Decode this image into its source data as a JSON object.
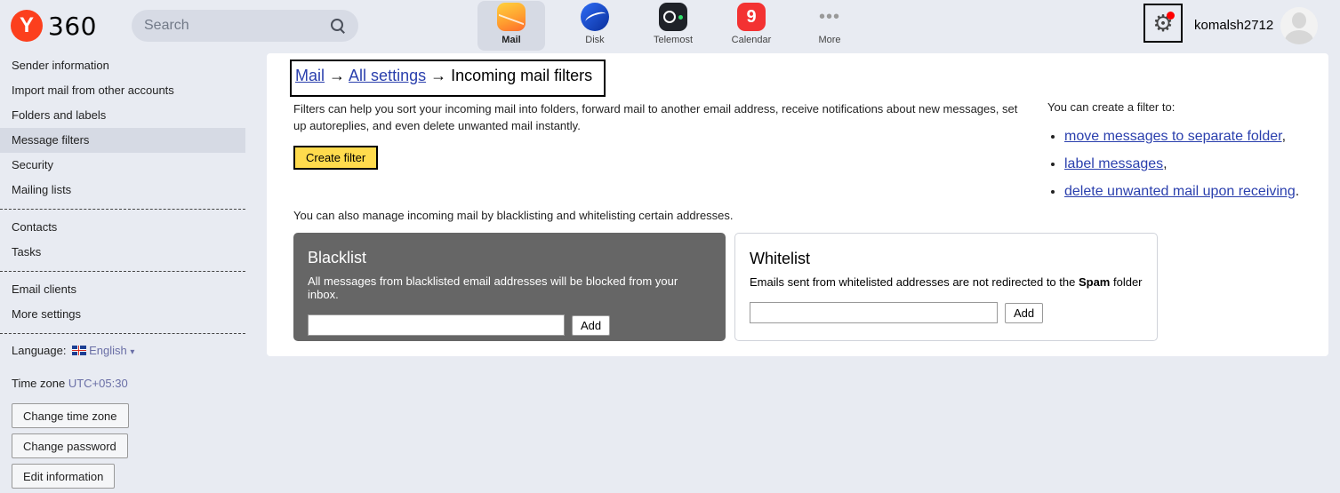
{
  "header": {
    "logo_letter": "Y",
    "logo_text": "360",
    "search_placeholder": "Search",
    "apps": [
      {
        "label": "Mail",
        "icon": "mail-icon",
        "active": true
      },
      {
        "label": "Disk",
        "icon": "disk-icon"
      },
      {
        "label": "Telemost",
        "icon": "telemost-icon"
      },
      {
        "label": "Calendar",
        "icon": "calendar-icon",
        "badge": "9"
      },
      {
        "label": "More",
        "icon": "more-icon",
        "glyph": "•••"
      }
    ],
    "username": "komalsh2712",
    "gear_glyph": "⚙"
  },
  "sidebar": {
    "group1": [
      "Sender information",
      "Import mail from other accounts",
      "Folders and labels",
      "Message filters",
      "Security",
      "Mailing lists"
    ],
    "group2": [
      "Contacts",
      "Tasks"
    ],
    "group3": [
      "Email clients",
      "More settings"
    ],
    "language_label": "Language:",
    "language_value": "English",
    "language_caret": "▾",
    "timezone_label": "Time zone",
    "timezone_value": "UTC+05:30",
    "buttons": [
      "Change time zone",
      "Change password",
      "Edit information"
    ]
  },
  "main": {
    "breadcrumb": {
      "mail": "Mail",
      "arrow": "→",
      "all_settings": "All settings",
      "current": "Incoming mail filters"
    },
    "intro": "Filters can help you sort your incoming mail into folders, forward mail to another email address, receive notifications about new messages, set up autoreplies, and even delete unwanted mail instantly.",
    "create_button": "Create filter",
    "right_title": "You can create a filter to:",
    "right_links": [
      "move messages to separate folder",
      "label messages",
      "delete unwanted mail upon receiving"
    ],
    "right_punct": [
      ",",
      ",",
      "."
    ],
    "manage_text": "You can also manage incoming mail by blacklisting and whitelisting certain addresses.",
    "blacklist": {
      "title": "Blacklist",
      "desc": "All messages from blacklisted email addresses will be blocked from your inbox.",
      "add": "Add"
    },
    "whitelist": {
      "title": "Whitelist",
      "desc_before": "Emails sent from whitelisted addresses are not redirected to the ",
      "desc_bold": "Spam",
      "desc_after": " folder",
      "add": "Add"
    }
  },
  "colors": {
    "accent_button": "#ffdb4d",
    "link": "#2a3fad",
    "brand": "#fc3f1d",
    "blacklist_bg": "#666666"
  }
}
